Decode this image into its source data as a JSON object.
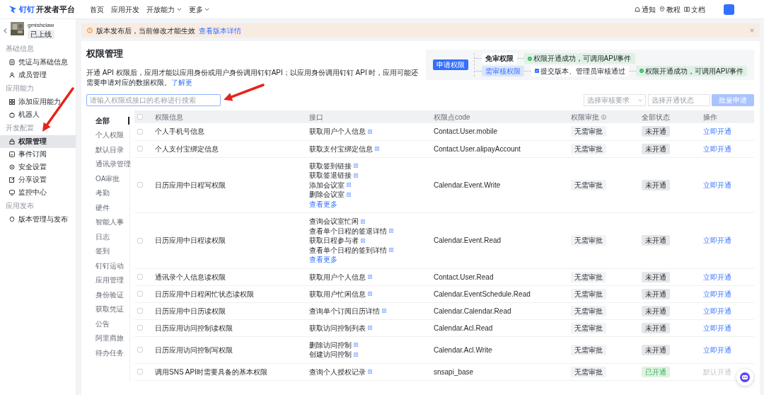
{
  "topbar": {
    "brand": "钉钉",
    "product": "开发者平台",
    "nav": [
      {
        "label": "首页",
        "dropdown": false
      },
      {
        "label": "应用开发",
        "dropdown": false
      },
      {
        "label": "开放能力",
        "dropdown": true
      },
      {
        "label": "更多",
        "dropdown": true
      }
    ],
    "tools": [
      "通知",
      "教程",
      "文档"
    ]
  },
  "sidebar": {
    "app_name": "gmishclaw",
    "app_status": "已上线",
    "groups": [
      {
        "title": "基础信息",
        "items": [
          {
            "label": "凭证与基础信息",
            "selected": false
          },
          {
            "label": "成员管理",
            "selected": false
          }
        ]
      },
      {
        "title": "应用能力",
        "items": [
          {
            "label": "添加应用能力",
            "selected": false
          },
          {
            "label": "机器人",
            "selected": false
          }
        ]
      },
      {
        "title": "开发配置",
        "items": [
          {
            "label": "权限管理",
            "selected": true
          },
          {
            "label": "事件订阅",
            "selected": false
          },
          {
            "label": "安全设置",
            "selected": false
          },
          {
            "label": "分享设置",
            "selected": false
          },
          {
            "label": "监控中心",
            "selected": false
          }
        ]
      },
      {
        "title": "应用发布",
        "items": [
          {
            "label": "版本管理与发布",
            "selected": false
          }
        ]
      }
    ]
  },
  "notice": {
    "text": "版本发布后，当前修改才能生效",
    "link": "查看版本详情"
  },
  "page": {
    "title": "权限管理",
    "description": "开通 API 权限后，应用才能以应用身份或用户身份调用钉钉API；以应用身份调用钉钉 API 时，应用可能还需要申请对应的数据权限。",
    "learn_more": "了解更"
  },
  "flow": {
    "start": "申请权限",
    "free": "免审权限",
    "free_result": "权限开通成功，可调用API/事件",
    "review": "需审核权限",
    "review_step": "提交版本、管理员审核通过",
    "review_result": "权限开通成功，可调用API/事件"
  },
  "search": {
    "placeholder": "请输入权限或接口的名称进行搜索"
  },
  "filters": [
    {
      "placeholder": "选择审核要求",
      "dropdown": true
    },
    {
      "placeholder": "选择开通状态",
      "dropdown": false
    }
  ],
  "batch_button": {
    "label": "批量申请",
    "disabled": true
  },
  "categories": [
    {
      "label": "全部",
      "selected": true
    },
    {
      "label": "个人权限",
      "selected": false
    },
    {
      "label": "默认目录",
      "selected": false
    },
    {
      "label": "通讯录管理",
      "selected": false
    },
    {
      "label": "OA审批",
      "selected": false
    },
    {
      "label": "考勤",
      "selected": false
    },
    {
      "label": "硬件",
      "selected": false
    },
    {
      "label": "智能人事",
      "selected": false
    },
    {
      "label": "日志",
      "selected": false
    },
    {
      "label": "签到",
      "selected": false
    },
    {
      "label": "钉钉运动",
      "selected": false
    },
    {
      "label": "应用管理",
      "selected": false
    },
    {
      "label": "身份验证",
      "selected": false
    },
    {
      "label": "获取凭证",
      "selected": false
    },
    {
      "label": "公告",
      "selected": false
    },
    {
      "label": "阿里商旅",
      "selected": false
    },
    {
      "label": "待办任务",
      "selected": false
    }
  ],
  "table": {
    "select_all": false,
    "columns": [
      "权限信息",
      "接口",
      "权限点code",
      "权限审批",
      "全部状态",
      "操作"
    ],
    "rows": [
      {
        "selected": false,
        "name": "个人手机号信息",
        "apis": [
          "获取用户个人信息"
        ],
        "code": "Contact.User.mobile",
        "approval": "无需审批",
        "status": "未开通",
        "opened": false,
        "action": "立即开通",
        "action_disabled": false
      },
      {
        "selected": false,
        "name": "个人支付宝绑定信息",
        "apis": [
          "获取支付宝绑定信息"
        ],
        "code": "Contact.User.alipayAccount",
        "approval": "无需审批",
        "status": "未开通",
        "opened": false,
        "action": "立即开通",
        "action_disabled": false
      },
      {
        "selected": false,
        "name": "日历应用中日程写权限",
        "apis": [
          "获取签到链接",
          "获取签退链接",
          "添加会议室",
          "删除会议室"
        ],
        "more": "查看更多",
        "code": "Calendar.Event.Write",
        "approval": "无需审批",
        "status": "未开通",
        "opened": false,
        "action": "立即开通",
        "action_disabled": false
      },
      {
        "selected": false,
        "name": "日历应用中日程读权限",
        "apis": [
          "查询会议室忙闲",
          "查看单个日程的签退详情",
          "获取日程参与者",
          "查看单个日程的签到详情"
        ],
        "more": "查看更多",
        "code": "Calendar.Event.Read",
        "approval": "无需审批",
        "status": "未开通",
        "opened": false,
        "action": "立即开通",
        "action_disabled": false
      },
      {
        "selected": false,
        "name": "通讯录个人信息读权限",
        "apis": [
          "获取用户个人信息"
        ],
        "code": "Contact.User.Read",
        "approval": "无需审批",
        "status": "未开通",
        "opened": false,
        "action": "立即开通",
        "action_disabled": false
      },
      {
        "selected": false,
        "name": "日历应用中日程闲忙状态读权限",
        "apis": [
          "获取用户忙闲信息"
        ],
        "code": "Calendar.EventSchedule.Read",
        "approval": "无需审批",
        "status": "未开通",
        "opened": false,
        "action": "立即开通",
        "action_disabled": false
      },
      {
        "selected": false,
        "name": "日历应用中日历读权限",
        "apis": [
          "查询单个订阅日历详情"
        ],
        "code": "Calendar.Calendar.Read",
        "approval": "无需审批",
        "status": "未开通",
        "opened": false,
        "action": "立即开通",
        "action_disabled": false
      },
      {
        "selected": false,
        "name": "日历应用访问控制读权限",
        "apis": [
          "获取访问控制列表"
        ],
        "code": "Calendar.Acl.Read",
        "approval": "无需审批",
        "status": "未开通",
        "opened": false,
        "action": "立即开通",
        "action_disabled": false
      },
      {
        "selected": false,
        "name": "日历应用访问控制写权限",
        "apis": [
          "删除访问控制",
          "创建访问控制"
        ],
        "code": "Calendar.Acl.Write",
        "approval": "无需审批",
        "status": "未开通",
        "opened": false,
        "action": "立即开通",
        "action_disabled": false
      },
      {
        "selected": false,
        "name": "调用SNS API时需要具备的基本权限",
        "apis": [
          "查询个人授权记录"
        ],
        "code": "snsapi_base",
        "approval": "无需审批",
        "status": "已开通",
        "opened": true,
        "action": "默认开通",
        "action_disabled": true
      }
    ]
  },
  "annotations": [
    {
      "kind": "arrow"
    },
    {
      "kind": "arrow"
    }
  ]
}
